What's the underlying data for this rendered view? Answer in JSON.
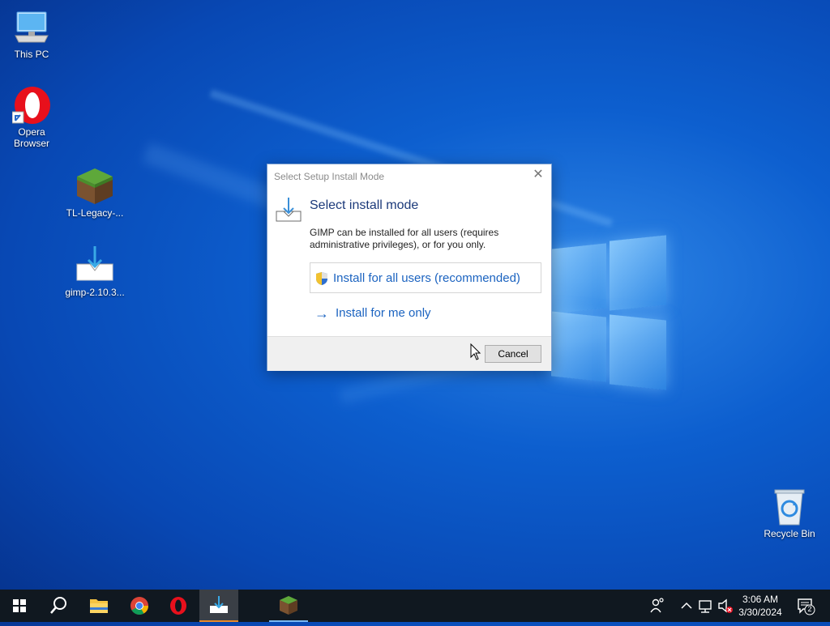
{
  "desktop": {
    "icons": [
      {
        "label": "This PC",
        "icon": "this-pc-icon"
      },
      {
        "label": "Opera Browser",
        "label_line1": "Opera",
        "label_line2": "Browser",
        "icon": "opera-icon"
      },
      {
        "label": "TL-Legacy-...",
        "icon": "minecraft-grass-block-icon"
      },
      {
        "label": "gimp-2.10.3...",
        "icon": "installer-download-icon"
      },
      {
        "label": "Recycle Bin",
        "icon": "recycle-bin-icon"
      }
    ]
  },
  "dialog": {
    "title": "Select Setup Install Mode",
    "heading": "Select install mode",
    "description": "GIMP can be installed for all users (requires administrative privileges), or for you only.",
    "option_all_users": "Install for all users (recommended)",
    "option_me_only": "Install for me only",
    "cancel_label": "Cancel",
    "accent_color": "#1b63c0"
  },
  "taskbar": {
    "apps": [
      {
        "name": "start",
        "icon": "windows-start-icon"
      },
      {
        "name": "search",
        "icon": "search-icon"
      },
      {
        "name": "file-explorer",
        "icon": "folder-icon"
      },
      {
        "name": "chrome",
        "icon": "chrome-icon"
      },
      {
        "name": "opera",
        "icon": "opera-icon"
      },
      {
        "name": "gimp-setup",
        "icon": "installer-download-icon",
        "active": true
      },
      {
        "name": "minecraft",
        "icon": "minecraft-grass-block-icon",
        "running": true
      }
    ],
    "clock_time": "3:06 AM",
    "clock_date": "3/30/2024",
    "notification_count": "2"
  }
}
